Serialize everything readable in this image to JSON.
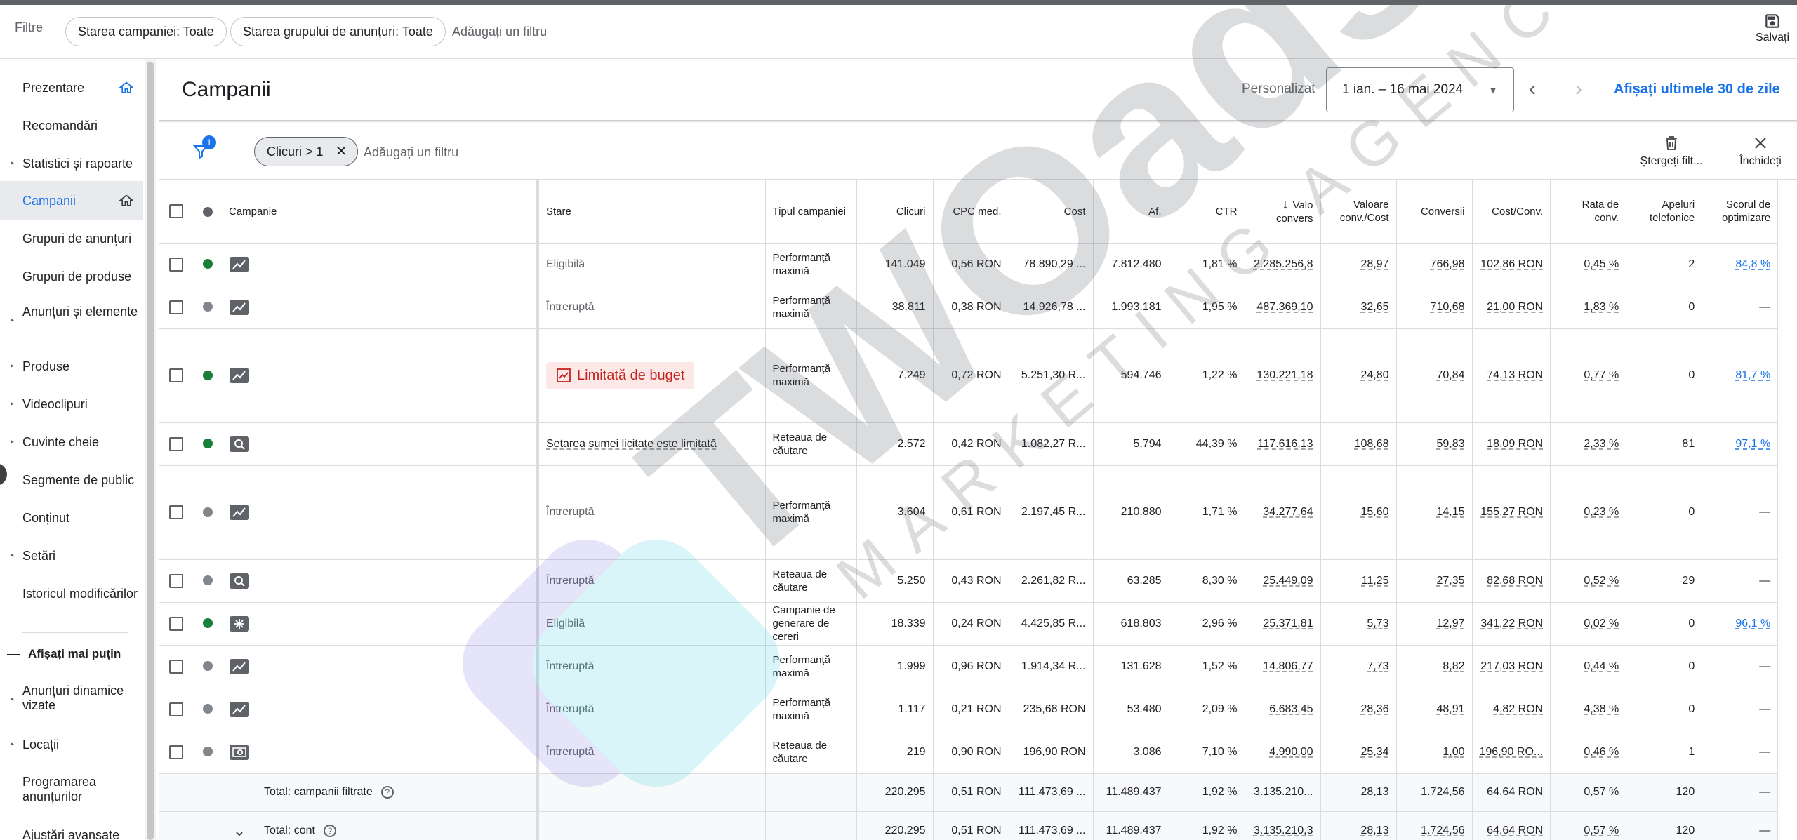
{
  "filterbar": {
    "label": "Filtre",
    "chips": [
      "Starea campaniei: Toate",
      "Starea grupului de anunțuri: Toate"
    ],
    "add_filter": "Adăugați un filtru",
    "save_label": "Salvați"
  },
  "sidebar": {
    "items": [
      {
        "label": "Prezentare",
        "arrow": "",
        "home": true
      },
      {
        "label": "Recomandări",
        "arrow": ""
      },
      {
        "label": "Statistici și rapoarte",
        "arrow": "▸"
      },
      {
        "label": "Campanii",
        "arrow": "",
        "home": true,
        "active": true
      },
      {
        "label": "Grupuri de anunțuri",
        "arrow": ""
      },
      {
        "label": "Grupuri de produse",
        "arrow": ""
      },
      {
        "label": "Anunțuri și elemente",
        "arrow": "▸"
      },
      {
        "label": "Produse",
        "arrow": "▸"
      },
      {
        "label": "Videoclipuri",
        "arrow": "▸"
      },
      {
        "label": "Cuvinte cheie",
        "arrow": "▸"
      },
      {
        "label": "Segmente de public",
        "arrow": ""
      },
      {
        "label": "Conținut",
        "arrow": ""
      },
      {
        "label": "Setări",
        "arrow": "▸"
      },
      {
        "label": "Istoricul modificărilor",
        "arrow": ""
      },
      {
        "label": "Anunțuri dinamice vizate",
        "arrow": "▸"
      },
      {
        "label": "Locații",
        "arrow": "▸"
      },
      {
        "label": "Programarea anunțurilor",
        "arrow": ""
      },
      {
        "label": "Ajustări avansate",
        "arrow": ""
      }
    ],
    "show_less": "Afișați mai puțin"
  },
  "header": {
    "title": "Campanii",
    "custom_label": "Personalizat",
    "date_range": "1 ian. – 16 mai 2024",
    "last30": "Afișați ultimele 30 de zile"
  },
  "table_filter": {
    "badge": "1",
    "chip": "Clicuri > 1",
    "add_filter": "Adăugați un filtru",
    "clear_label": "Ștergeți filt...",
    "close_label": "Închideți"
  },
  "table": {
    "columns": [
      "Campanie",
      "Stare",
      "Tipul campaniei",
      "Clicuri",
      "CPC med.",
      "Cost",
      "Af.",
      "CTR",
      "Valo convers",
      "Valoare conv./Cost",
      "Conversii",
      "Cost/Conv.",
      "Rata de conv.",
      "Apeluri telefonice",
      "Scorul de optimizare"
    ],
    "rows": [
      {
        "dot": "green",
        "icon": "chart",
        "stare": "Eligibilă",
        "tip": "Performanță maximă",
        "clicuri": "141.049",
        "cpc": "0,56 RON",
        "cost": "78.890,29 ...",
        "af": "7.812.480",
        "ctr": "1,81 %",
        "valconv": "2.285.256,8",
        "valcost": "28,97",
        "conv": "766,98",
        "costconv": "102,86 RON",
        "rata": "0,45 %",
        "apel": "2",
        "scor": "84,8 %"
      },
      {
        "dot": "pause",
        "icon": "chart",
        "stare": "Întreruptă",
        "tip": "Performanță maximă",
        "clicuri": "38.811",
        "cpc": "0,38 RON",
        "cost": "14.926,78 ...",
        "af": "1.993.181",
        "ctr": "1,95 %",
        "valconv": "487.369,10",
        "valcost": "32,65",
        "conv": "710,68",
        "costconv": "21,00 RON",
        "rata": "1,83 %",
        "apel": "0",
        "scor": "—"
      },
      {
        "dot": "green",
        "icon": "chart",
        "stare": "Limitată de buget",
        "tip": "Performanță maximă",
        "clicuri": "7.249",
        "cpc": "0,72 RON",
        "cost": "5.251,30 R...",
        "af": "594.746",
        "ctr": "1,22 %",
        "valconv": "130.221,18",
        "valcost": "24,80",
        "conv": "70,84",
        "costconv": "74,13 RON",
        "rata": "0,77 %",
        "apel": "0",
        "scor": "81,7 %"
      },
      {
        "dot": "green",
        "icon": "search",
        "stare": "Setarea sumei licitate este limitată",
        "tip": "Rețeaua de căutare",
        "clicuri": "2.572",
        "cpc": "0,42 RON",
        "cost": "1.082,27 R...",
        "af": "5.794",
        "ctr": "44,39 %",
        "valconv": "117.616,13",
        "valcost": "108,68",
        "conv": "59,83",
        "costconv": "18,09 RON",
        "rata": "2,33 %",
        "apel": "81",
        "scor": "97,1 %"
      },
      {
        "dot": "pause",
        "icon": "chart",
        "stare": "Întreruptă",
        "tip": "Performanță maximă",
        "clicuri": "3.604",
        "cpc": "0,61 RON",
        "cost": "2.197,45 R...",
        "af": "210.880",
        "ctr": "1,71 %",
        "valconv": "34.277,64",
        "valcost": "15,60",
        "conv": "14,15",
        "costconv": "155,27 RON",
        "rata": "0,23 %",
        "apel": "0",
        "scor": "—"
      },
      {
        "dot": "pause",
        "icon": "search",
        "stare": "Întreruptă",
        "tip": "Rețeaua de căutare",
        "clicuri": "5.250",
        "cpc": "0,43 RON",
        "cost": "2.261,82 R...",
        "af": "63.285",
        "ctr": "8,30 %",
        "valconv": "25.449,09",
        "valcost": "11,25",
        "conv": "27,35",
        "costconv": "82,68 RON",
        "rata": "0,52 %",
        "apel": "29",
        "scor": "—"
      },
      {
        "dot": "green",
        "icon": "spark",
        "stare": "Eligibilă",
        "tip": "Campanie de generare de cereri",
        "clicuri": "18.339",
        "cpc": "0,24 RON",
        "cost": "4.425,85 R...",
        "af": "618.803",
        "ctr": "2,96 %",
        "valconv": "25.371,81",
        "valcost": "5,73",
        "conv": "12,97",
        "costconv": "341,22 RON",
        "rata": "0,02 %",
        "apel": "0",
        "scor": "96,1 %"
      },
      {
        "dot": "pause",
        "icon": "chart",
        "stare": "Întreruptă",
        "tip": "Performanță maximă",
        "clicuri": "1.999",
        "cpc": "0,96 RON",
        "cost": "1.914,34 R...",
        "af": "131.628",
        "ctr": "1,52 %",
        "valconv": "14.806,77",
        "valcost": "7,73",
        "conv": "8,82",
        "costconv": "217,03 RON",
        "rata": "0,44 %",
        "apel": "0",
        "scor": "—"
      },
      {
        "dot": "pause",
        "icon": "chart",
        "stare": "Întreruptă",
        "tip": "Performanță maximă",
        "clicuri": "1.117",
        "cpc": "0,21 RON",
        "cost": "235,68 RON",
        "af": "53.480",
        "ctr": "2,09 %",
        "valconv": "6.683,45",
        "valcost": "28,36",
        "conv": "48,91",
        "costconv": "4,82 RON",
        "rata": "4,38 %",
        "apel": "0",
        "scor": "—"
      },
      {
        "dot": "pause",
        "icon": "search2",
        "stare": "Întreruptă",
        "tip": "Rețeaua de căutare",
        "clicuri": "219",
        "cpc": "0,90 RON",
        "cost": "196,90 RON",
        "af": "3.086",
        "ctr": "7,10 %",
        "valconv": "4.990,00",
        "valcost": "25,34",
        "conv": "1,00",
        "costconv": "196,90 RO...",
        "rata": "0,46 %",
        "apel": "1",
        "scor": "—"
      }
    ],
    "totals": [
      {
        "label": "Total: campanii filtrate",
        "clicuri": "220.295",
        "cpc": "0,51 RON",
        "cost": "111.473,69 ...",
        "af": "11.489.437",
        "ctr": "1,92 %",
        "valconv": "3.135.210...",
        "valcost": "28,13",
        "conv": "1.724,56",
        "costconv": "64,64 RON",
        "rata": "0,57 %",
        "apel": "120",
        "scor": "—"
      },
      {
        "label": "Total: cont",
        "clicuri": "220.295",
        "cpc": "0,51 RON",
        "cost": "111.473,69 ...",
        "af": "11.489.437",
        "ctr": "1,92 %",
        "valconv": "3.135.210,3",
        "valcost": "28,13",
        "conv": "1.724,56",
        "costconv": "64,64 RON",
        "rata": "0,57 %",
        "apel": "120",
        "scor": "—"
      }
    ]
  },
  "watermark": {
    "brand": "TWOads",
    "sub": "MARKETING AGENCY"
  }
}
